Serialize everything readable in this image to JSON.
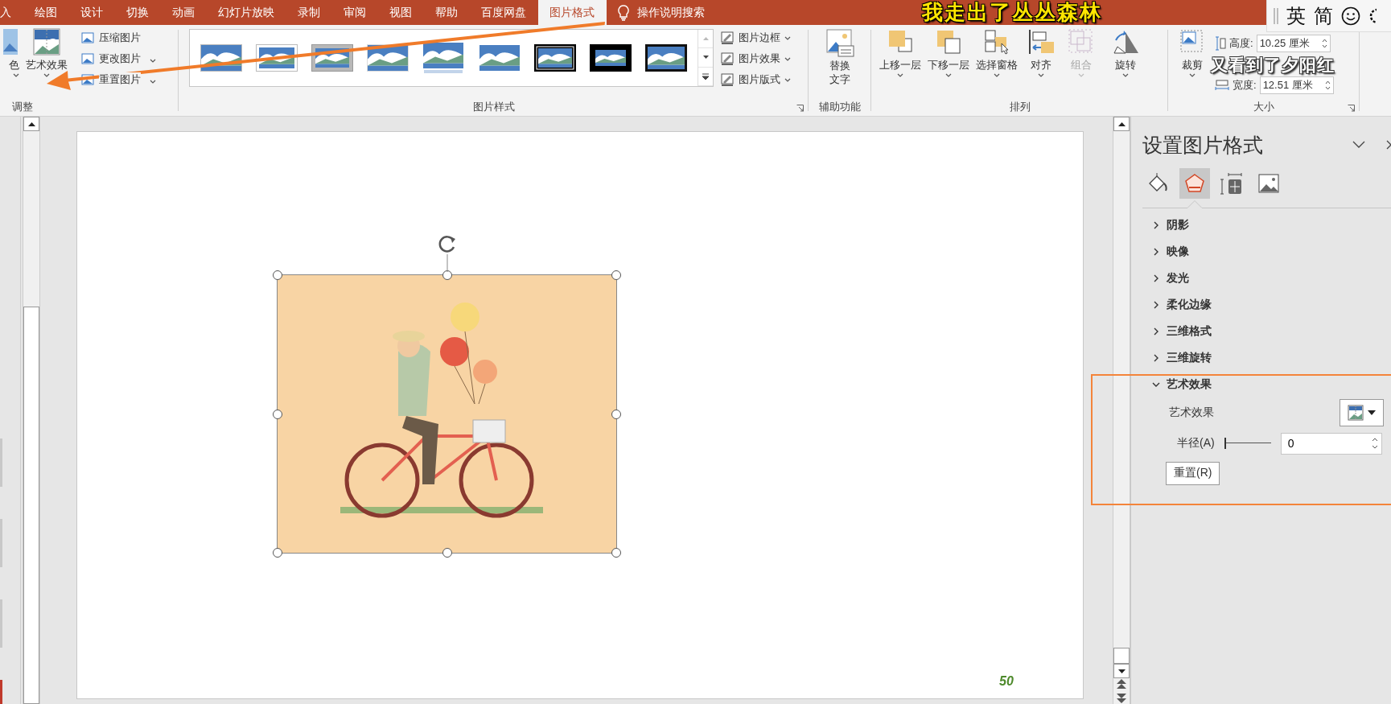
{
  "ribbon_tabs": [
    {
      "label": "入",
      "selected": false
    },
    {
      "label": "绘图",
      "selected": false
    },
    {
      "label": "设计",
      "selected": false
    },
    {
      "label": "切换",
      "selected": false
    },
    {
      "label": "动画",
      "selected": false
    },
    {
      "label": "幻灯片放映",
      "selected": false
    },
    {
      "label": "录制",
      "selected": false
    },
    {
      "label": "审阅",
      "selected": false
    },
    {
      "label": "视图",
      "selected": false
    },
    {
      "label": "帮助",
      "selected": false
    },
    {
      "label": "百度网盘",
      "selected": false
    },
    {
      "label": "图片格式",
      "selected": true
    }
  ],
  "tell_me": "操作说明搜索",
  "lyrics": [
    "我走出了丛丛森林",
    "又看到了夕阳红"
  ],
  "ime_bar": [
    "英",
    "简"
  ],
  "adjust_group": {
    "label": "调整",
    "big_buttons": [
      "色",
      "艺术效果"
    ],
    "small_buttons": [
      {
        "label": "压缩图片",
        "dropdown": false
      },
      {
        "label": "更改图片",
        "dropdown": true
      },
      {
        "label": "重置图片",
        "dropdown": true
      }
    ]
  },
  "styles_group": {
    "label": "图片样式",
    "styles": [
      {
        "kind": "shadow"
      },
      {
        "kind": "white-frame"
      },
      {
        "kind": "gray-frame"
      },
      {
        "kind": "soft-shadow"
      },
      {
        "kind": "reflection"
      },
      {
        "kind": "soft-edge"
      },
      {
        "kind": "double-frame"
      },
      {
        "kind": "black-frame"
      },
      {
        "kind": "thin-black"
      }
    ],
    "side_buttons": [
      "图片边框",
      "图片效果",
      "图片版式"
    ]
  },
  "accessibility_group": {
    "label": "辅助功能",
    "button": "替换文字"
  },
  "arrange_group": {
    "label": "排列",
    "buttons": [
      {
        "label": "上移一层",
        "disabled": false
      },
      {
        "label": "下移一层",
        "disabled": false
      },
      {
        "label": "选择窗格",
        "disabled": false
      },
      {
        "label": "对齐",
        "disabled": false
      },
      {
        "label": "组合",
        "disabled": true
      },
      {
        "label": "旋转",
        "disabled": false
      }
    ]
  },
  "size_group": {
    "label": "大小",
    "crop": "裁剪",
    "height_label": "高度:",
    "height": "10.25 厘米",
    "width_label": "宽度:",
    "width": "12.51 厘米"
  },
  "slide": {
    "page_number": "50"
  },
  "format_pane": {
    "title": "设置图片格式",
    "tabs": [
      {
        "kind": "fill",
        "selected": false
      },
      {
        "kind": "effects",
        "selected": true
      },
      {
        "kind": "size",
        "selected": false
      },
      {
        "kind": "picture",
        "selected": false
      }
    ],
    "sections": [
      {
        "label": "阴影",
        "expanded": false
      },
      {
        "label": "映像",
        "expanded": false
      },
      {
        "label": "发光",
        "expanded": false
      },
      {
        "label": "柔化边缘",
        "expanded": false
      },
      {
        "label": "三维格式",
        "expanded": false
      },
      {
        "label": "三维旋转",
        "expanded": false
      },
      {
        "label": "艺术效果",
        "expanded": true
      }
    ],
    "artistic": {
      "effect_label": "艺术效果",
      "radius_label": "半径(A)",
      "radius": {
        "level": 0,
        "value": "0"
      },
      "reset": "重置(R)"
    }
  }
}
